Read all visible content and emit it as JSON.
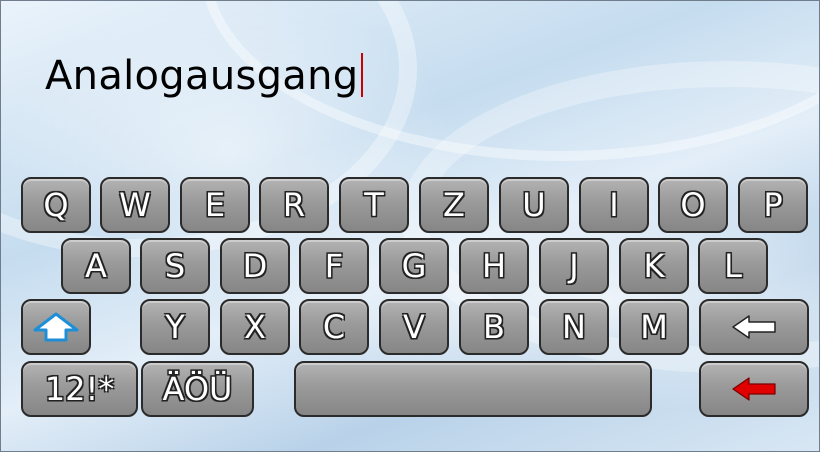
{
  "input": {
    "text": "Analogausgang"
  },
  "keyboard": {
    "row1": [
      "Q",
      "W",
      "E",
      "R",
      "T",
      "Z",
      "U",
      "I",
      "O",
      "P"
    ],
    "row2": [
      "A",
      "S",
      "D",
      "F",
      "G",
      "H",
      "J",
      "K",
      "L"
    ],
    "row3": [
      "Y",
      "X",
      "C",
      "V",
      "B",
      "N",
      "M"
    ],
    "numbers_label": "12!*",
    "umlaut_label": "ÄÖÜ",
    "shift_icon": "shift-up-arrow-icon",
    "backspace_icon": "left-arrow-icon",
    "enter_icon": "red-left-arrow-icon",
    "colors": {
      "shift": "#1e8fd6",
      "enter": "#e00000",
      "cursor": "#cc0000"
    }
  }
}
